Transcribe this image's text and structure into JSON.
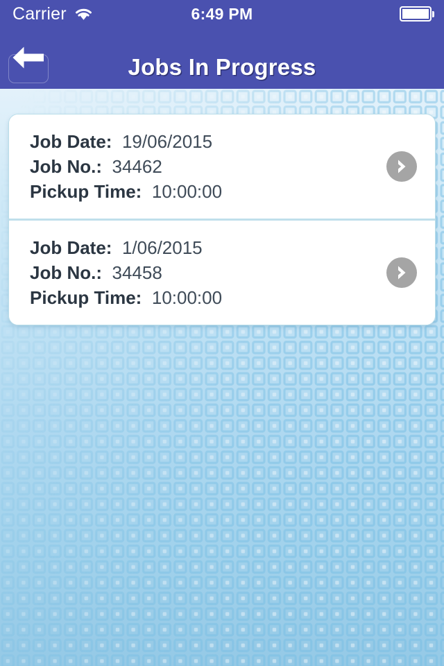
{
  "status_bar": {
    "carrier": "Carrier",
    "wifi_icon": "wifi-icon",
    "time": "6:49 PM",
    "battery_icon": "battery-full-icon"
  },
  "nav_bar": {
    "title": "Jobs In Progress",
    "back_icon": "arrow-left-icon",
    "background_color": "#4a51af",
    "title_color": "#ffffff"
  },
  "job_list": {
    "labels": {
      "job_date": "Job Date:",
      "job_no": "Job No.:",
      "pickup_time": "Pickup Time:"
    },
    "disclosure_icon": "chevron-right-icon",
    "accent_color": "#a5a5a5",
    "card_border_color": "#b9dde9",
    "items": [
      {
        "job_date": "19/06/2015",
        "job_no": "34462",
        "pickup_time": "10:00:00"
      },
      {
        "job_date": "1/06/2015",
        "job_no": "34458",
        "pickup_time": "10:00:00"
      }
    ]
  },
  "background": {
    "pattern_icon": "square-grid-pattern",
    "top_color": "#fbfcfe",
    "bottom_color": "#95c9e6",
    "pattern_color": "#7cc0e4"
  }
}
